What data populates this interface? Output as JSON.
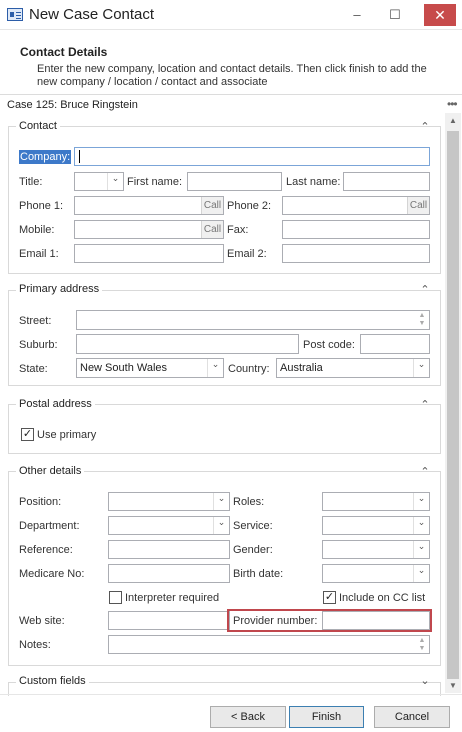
{
  "window": {
    "title": "New Case Contact",
    "minimize": "–",
    "maximize": "☐",
    "close": "✕"
  },
  "header": {
    "title": "Contact Details",
    "description": "Enter the new company, location and contact details. Then click finish to add the new company / location / contact and associate"
  },
  "case": {
    "label": "Case  125: Bruce Ringstein",
    "menu": "•••"
  },
  "contact": {
    "title": "Contact",
    "company_label": "Company:",
    "title_label": "Title:",
    "first_name_label": "First name:",
    "last_name_label": "Last name:",
    "phone1_label": "Phone 1:",
    "phone2_label": "Phone 2:",
    "call_label": "Call",
    "mobile_label": "Mobile:",
    "fax_label": "Fax:",
    "email1_label": "Email 1:",
    "email2_label": "Email 2:"
  },
  "primary_address": {
    "title": "Primary address",
    "street_label": "Street:",
    "suburb_label": "Suburb:",
    "postcode_label": "Post code:",
    "state_label": "State:",
    "state_value": "New South Wales",
    "country_label": "Country:",
    "country_value": "Australia"
  },
  "postal_address": {
    "title": "Postal address",
    "use_primary_label": "Use primary",
    "use_primary_checked": true
  },
  "other_details": {
    "title": "Other details",
    "position_label": "Position:",
    "roles_label": "Roles:",
    "department_label": "Department:",
    "service_label": "Service:",
    "reference_label": "Reference:",
    "gender_label": "Gender:",
    "medicare_label": "Medicare No:",
    "birth_date_label": "Birth date:",
    "interpreter_label": "Interpreter required",
    "interpreter_checked": false,
    "cc_list_label": "Include on CC list",
    "cc_list_checked": true,
    "website_label": "Web site:",
    "provider_label": "Provider number:",
    "notes_label": "Notes:"
  },
  "custom_fields": {
    "title": "Custom fields"
  },
  "buttons": {
    "back": "< Back",
    "finish": "Finish",
    "cancel": "Cancel"
  },
  "icons": {
    "check": "✓",
    "collapse": "⌃",
    "expand": "⌄",
    "dropdown": "⌄"
  }
}
